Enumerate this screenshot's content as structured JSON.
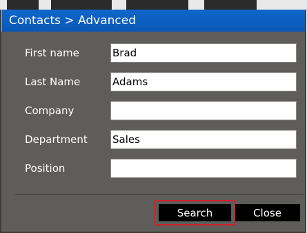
{
  "window": {
    "title": "Contacts > Advanced"
  },
  "form": {
    "fields": [
      {
        "label": "First name",
        "value": "Brad"
      },
      {
        "label": "Last Name",
        "value": "Adams"
      },
      {
        "label": "Company",
        "value": ""
      },
      {
        "label": "Department",
        "value": "Sales"
      },
      {
        "label": "Position",
        "value": ""
      }
    ]
  },
  "buttons": {
    "search_label": "Search",
    "close_label": "Close"
  },
  "colors": {
    "titlebar": "#0f66cc",
    "window_bg": "#5e5d5a",
    "button_bg": "#000000",
    "highlight": "#d1202a"
  }
}
